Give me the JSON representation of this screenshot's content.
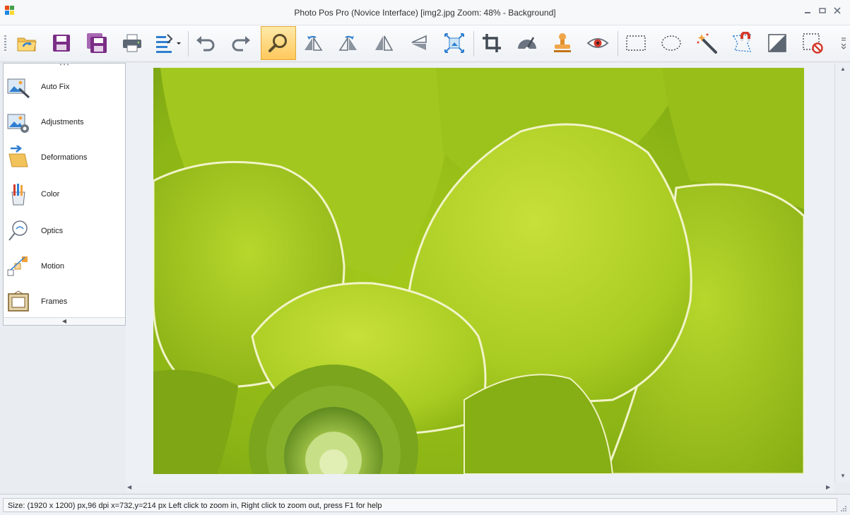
{
  "window": {
    "title": "Photo Pos Pro (Novice Interface) [img2.jpg Zoom: 48% - Background]",
    "minimize_icon": "minimize-icon",
    "restore_icon": "restore-icon",
    "close_icon": "close-icon"
  },
  "toolbar": {
    "active_tool": "zoom",
    "buttons": [
      {
        "id": "open",
        "icon": "open-folder-icon"
      },
      {
        "id": "save",
        "icon": "save-icon"
      },
      {
        "id": "save-as",
        "icon": "save-as-icon"
      },
      {
        "id": "print",
        "icon": "printer-icon"
      },
      {
        "id": "batch",
        "icon": "batch-menu-icon"
      },
      {
        "id": "undo",
        "icon": "undo-icon"
      },
      {
        "id": "redo",
        "icon": "redo-icon"
      },
      {
        "id": "zoom",
        "icon": "magnifier-icon"
      },
      {
        "id": "rotate-left",
        "icon": "rotate-left-icon"
      },
      {
        "id": "rotate-right",
        "icon": "rotate-right-icon"
      },
      {
        "id": "flip-horizontal",
        "icon": "flip-horizontal-icon"
      },
      {
        "id": "flip-vertical",
        "icon": "flip-vertical-icon"
      },
      {
        "id": "resize",
        "icon": "resize-icon"
      },
      {
        "id": "crop",
        "icon": "crop-icon"
      },
      {
        "id": "straighten",
        "icon": "straighten-icon"
      },
      {
        "id": "clone-stamp",
        "icon": "stamp-icon"
      },
      {
        "id": "red-eye",
        "icon": "eye-icon"
      },
      {
        "id": "rect-select",
        "icon": "rect-select-icon"
      },
      {
        "id": "ellipse-select",
        "icon": "ellipse-select-icon"
      },
      {
        "id": "magic-wand",
        "icon": "magic-wand-icon"
      },
      {
        "id": "magnetic-lasso",
        "icon": "magnet-lasso-icon"
      },
      {
        "id": "invert-selection",
        "icon": "invert-selection-icon"
      },
      {
        "id": "deselect",
        "icon": "deselect-icon"
      }
    ]
  },
  "sidebar": {
    "items": [
      {
        "label": "Auto Fix",
        "icon": "auto-fix-icon"
      },
      {
        "label": "Adjustments",
        "icon": "adjustments-icon"
      },
      {
        "label": "Deformations",
        "icon": "deformations-icon"
      },
      {
        "label": "Color",
        "icon": "color-icon"
      },
      {
        "label": "Optics",
        "icon": "optics-icon"
      },
      {
        "label": "Motion",
        "icon": "motion-icon"
      },
      {
        "label": "Frames",
        "icon": "frames-icon"
      }
    ]
  },
  "status": {
    "text": "Size: (1920 x 1200) px,96 dpi   x=732,y=214 px   Left click to zoom in, Right click to zoom out, press F1 for help"
  },
  "colors": {
    "accent_active": "#ffc85c",
    "save_purple": "#7b2e86",
    "leaf_green": "#9cc41c"
  }
}
